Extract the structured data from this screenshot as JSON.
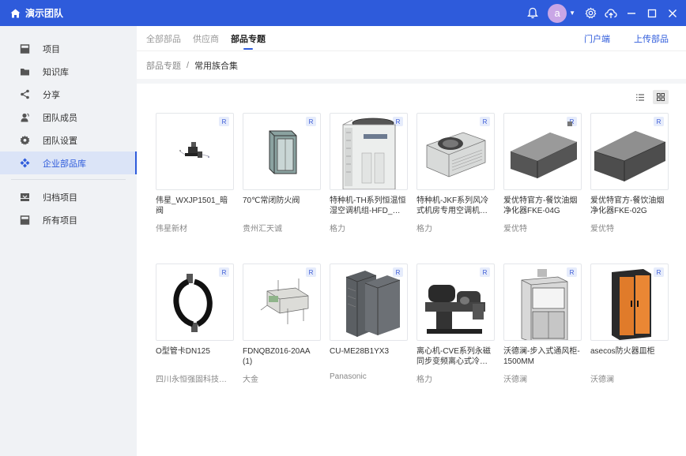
{
  "app": {
    "team_name": "演示团队",
    "avatar_letter": "a"
  },
  "sidebar": {
    "items": [
      {
        "label": "项目",
        "icon": "project-icon"
      },
      {
        "label": "知识库",
        "icon": "folder-icon"
      },
      {
        "label": "分享",
        "icon": "share-icon"
      },
      {
        "label": "团队成员",
        "icon": "team-members-icon"
      },
      {
        "label": "团队设置",
        "icon": "gear-icon"
      },
      {
        "label": "企业部品库",
        "icon": "component-library-icon"
      }
    ],
    "items2": [
      {
        "label": "归档项目",
        "icon": "archive-icon"
      },
      {
        "label": "所有项目",
        "icon": "all-projects-icon"
      }
    ]
  },
  "tabs": [
    {
      "label": "全部部品"
    },
    {
      "label": "供应商"
    },
    {
      "label": "部品专题"
    }
  ],
  "actions": {
    "portal": "门户端",
    "upload": "上传部品"
  },
  "breadcrumb": {
    "root": "部品专题",
    "sep": "/",
    "current": "常用族合集"
  },
  "badge_label": "R",
  "cards": [
    {
      "name": "伟星_WXJP1501_暗阀",
      "brand": "伟星新材"
    },
    {
      "name": "70℃常闭防火阀",
      "brand": "贵州汇天诚"
    },
    {
      "name": "特种机-TH系列恒温恒湿空调机组-HFD_…",
      "brand": "格力"
    },
    {
      "name": "特种机-JKF系列风冷式机房专用空调机…",
      "brand": "格力"
    },
    {
      "name": "爱优特官方-餐饮油烟净化器FKE-04G",
      "brand": "爱优特"
    },
    {
      "name": "爱优特官方-餐饮油烟净化器FKE-02G",
      "brand": "爱优特"
    },
    {
      "name": "O型管卡DN125",
      "brand": "四川永恒强固科技…"
    },
    {
      "name": "FDNQBZ016-20AA (1)",
      "brand": "大金"
    },
    {
      "name": "CU-ME28B1YX3",
      "brand": "Panasonic"
    },
    {
      "name": "离心机-CVE系列永磁同步变频离心式冷…",
      "brand": "格力"
    },
    {
      "name": "沃德澜-步入式通风柜-1500MM",
      "brand": "沃德澜"
    },
    {
      "name": "asecos防火器皿柜",
      "brand": "沃德澜"
    }
  ]
}
